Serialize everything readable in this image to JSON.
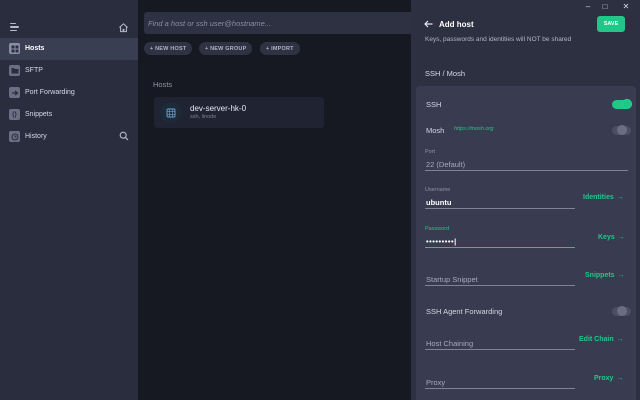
{
  "sidebar": {
    "items": [
      {
        "label": "Hosts",
        "icon": "hosts-icon",
        "active": true
      },
      {
        "label": "SFTP",
        "icon": "folder-icon",
        "active": false
      },
      {
        "label": "Port Forwarding",
        "icon": "port-forwarding-icon",
        "active": false
      },
      {
        "label": "Snippets",
        "icon": "snippets-icon",
        "active": false
      },
      {
        "label": "History",
        "icon": "history-icon",
        "active": false
      }
    ]
  },
  "main": {
    "search_placeholder": "Find a host or ssh user@hostname...",
    "chips": {
      "new_host": "+ NEW HOST",
      "new_group": "+ NEW GROUP",
      "import": "+ IMPORT"
    },
    "hosts_title": "Hosts",
    "host": {
      "name": "dev-server-hk-0",
      "sub": "ssh, linode"
    }
  },
  "panel": {
    "window_controls": {
      "minimize": "–",
      "maximize": "□",
      "close": "✕"
    },
    "title": "Add host",
    "save_label": "SAVE",
    "note": "Keys, passwords and identities will NOT be shared",
    "section": "SSH / Mosh",
    "ssh": {
      "label": "SSH",
      "enabled": true
    },
    "mosh": {
      "label": "Mosh",
      "link": "https://mosh.org",
      "enabled": false
    },
    "port": {
      "caption": "Port",
      "placeholder": "22 (Default)"
    },
    "username": {
      "caption": "Username",
      "value": "ubuntu",
      "action": "Identities"
    },
    "password": {
      "caption": "Password",
      "value": "•••••••••|",
      "action": "Keys"
    },
    "startup": {
      "placeholder": "Startup Snippet",
      "action": "Snippets"
    },
    "agent": {
      "label": "SSH Agent Forwarding",
      "enabled": false
    },
    "chaining": {
      "placeholder": "Host Chaining",
      "action": "Edit Chain"
    },
    "proxy": {
      "placeholder": "Proxy",
      "action": "Proxy"
    },
    "arrow": "→"
  },
  "colors": {
    "accent": "#20c787",
    "sidebar": "#2a2d3d",
    "main_bg": "#171922",
    "panel": "#2d3040",
    "card": "#393c50"
  }
}
